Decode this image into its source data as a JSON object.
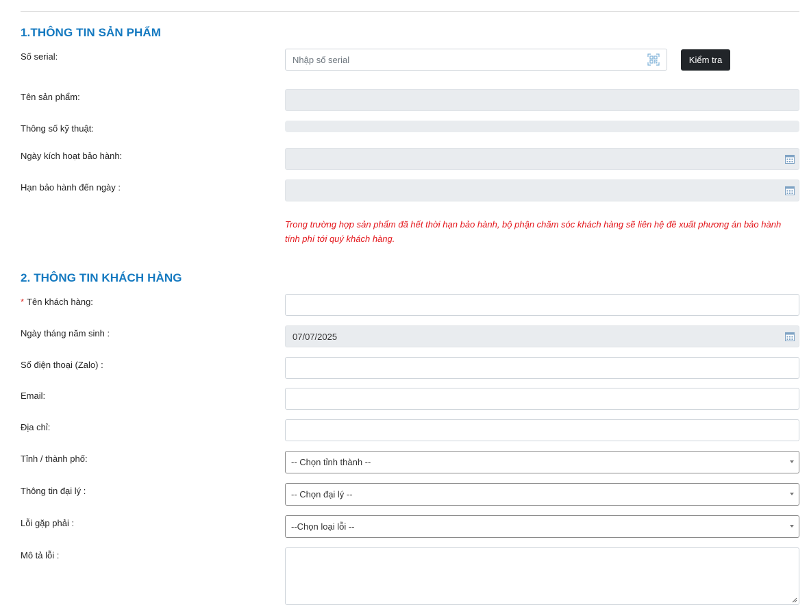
{
  "section1": {
    "title": "1.THÔNG TIN SẢN PHẨM",
    "serial_label": "Số serial:",
    "serial_placeholder": "Nhập số serial",
    "check_button": "Kiểm tra",
    "product_name_label": "Tên sản phẩm:",
    "specs_label": "Thông số kỹ thuật:",
    "activation_date_label": "Ngày kích hoạt bảo hành:",
    "warranty_until_label": "Hạn bảo hành đến ngày :",
    "note": "Trong trường hợp sản phẩm đã hết thời hạn bảo hành, bộ phận chăm sóc khách hàng sẽ liên hệ đề xuất phương án bảo hành tính phí tới quý khách hàng."
  },
  "section2": {
    "title": "2. THÔNG TIN KHÁCH HÀNG",
    "required_mark": "*",
    "customer_name_label": "Tên khách hàng:",
    "birthdate_label": "Ngày tháng năm sinh :",
    "birthdate_value": "07/07/2025",
    "phone_label": "Số điện thoại (Zalo) :",
    "email_label": "Email:",
    "address_label": "Địa chỉ:",
    "province_label": "Tỉnh / thành phố:",
    "province_selected": "-- Chọn tỉnh thành --",
    "dealer_label": "Thông tin đại lý :",
    "dealer_selected": "-- Chọn đại lý --",
    "error_label": "Lỗi gặp phải :",
    "error_selected": "--Chọn loại lỗi --",
    "error_desc_label": "Mô tả lỗi :"
  },
  "colors": {
    "section_title": "#1479c0",
    "note": "#e3151a",
    "required": "#e0342f",
    "button_bg": "#212529",
    "disabled_bg": "#e9ecef"
  },
  "icons": {
    "serial_scan": "qr-scan-icon",
    "date": "calendar-icon",
    "select": "caret-down-icon"
  }
}
